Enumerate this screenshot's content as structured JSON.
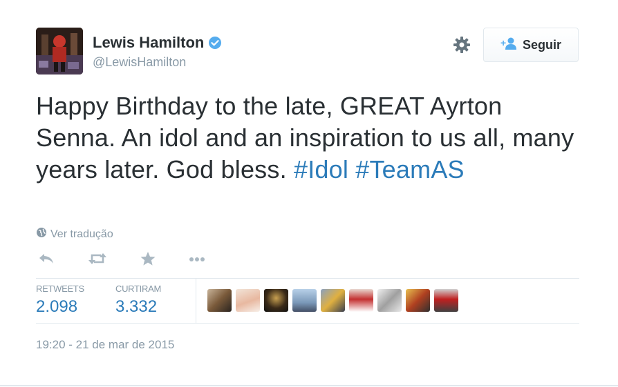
{
  "user": {
    "name": "Lewis Hamilton",
    "handle": "@LewisHamilton",
    "verified": true,
    "follow_label": "Seguir"
  },
  "tweet": {
    "text_plain": "Happy Birthday to the late, GREAT Ayrton Senna. An idol and an inspiration to us all, many years later. God bless.",
    "hashtags": [
      "#Idol",
      "#TeamAS"
    ],
    "translate_label": "Ver tradução"
  },
  "actions": [
    "reply-icon",
    "retweet-icon",
    "favorite-icon",
    "more-icon"
  ],
  "stats": {
    "retweets_label": "RETWEETS",
    "retweets_value": "2.098",
    "likes_label": "CURTIRAM",
    "likes_value": "3.332"
  },
  "timestamp": "19:20 - 21 de mar de 2015",
  "colors": {
    "link": "#2b7bb9",
    "muted": "#8899a6",
    "text": "#292f33",
    "verified": "#55acee",
    "border": "#e1e8ed"
  }
}
